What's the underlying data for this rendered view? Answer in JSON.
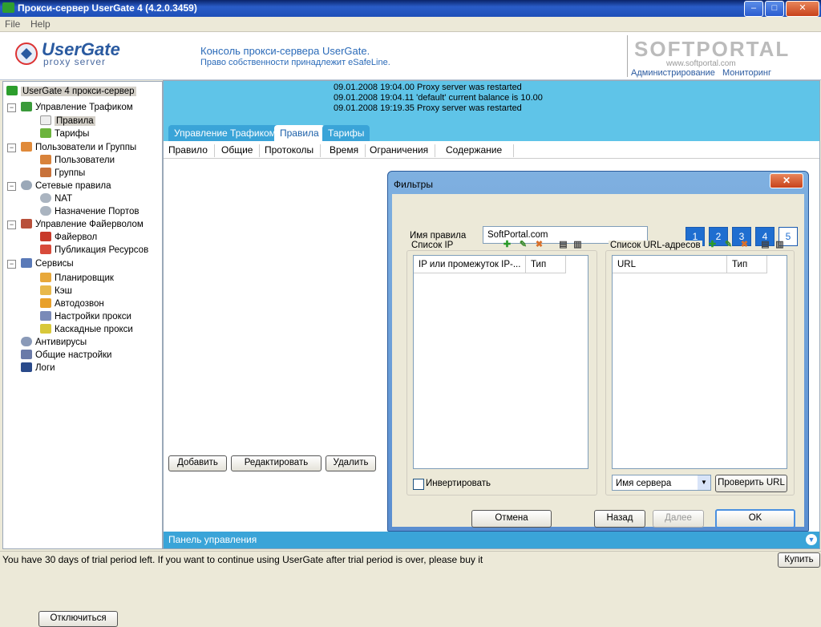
{
  "window": {
    "title": "Прокси-сервер UserGate 4 (4.2.0.3459)",
    "min": "–",
    "max": "□",
    "close": "✕"
  },
  "menu": {
    "file": "File",
    "help": "Help"
  },
  "header": {
    "logo_main": "UserGate",
    "logo_sub": "proxy server",
    "line1": "Консоль прокси-сервера UserGate.",
    "line2": "Право собственности принадлежит eSafeLine.",
    "watermark": "SOFTPORTAL",
    "watermark_url": "www.softportal.com",
    "admin_link": "Администрирование",
    "monitor_link": "Мониторинг"
  },
  "tree": {
    "root": "UserGate 4 прокси-сервер",
    "traffic": "Управление Трафиком",
    "rules": "Правила",
    "tariffs": "Тарифы",
    "users_groups": "Пользователи и Группы",
    "users": "Пользователи",
    "groups": "Группы",
    "net_rules": "Сетевые правила",
    "nat": "NAT",
    "ports": "Назначение Портов",
    "firewall_mgmt": "Управление Файерволом",
    "firewall": "Файервол",
    "publish": "Публикация Ресурсов",
    "services": "Сервисы",
    "scheduler": "Планировщик",
    "cache": "Кэш",
    "autodial": "Автодозвон",
    "proxy_settings": "Настройки прокси",
    "cascade": "Каскадные прокси",
    "antivirus": "Антивирусы",
    "general": "Общие настройки",
    "logs": "Логи"
  },
  "disconnect_label": "Отключиться",
  "log": [
    "09.01.2008 19:04.00 Proxy server was restarted",
    "09.01.2008 19:04.11 'default' current balance is 10.00",
    "09.01.2008 19:19.35 Proxy server was restarted"
  ],
  "tabs": [
    "Управление Трафиком",
    "Правила",
    "Тарифы"
  ],
  "columns": [
    "Правило",
    "Общие",
    "Протоколы",
    "Время",
    "Ограничения",
    "Содержание"
  ],
  "main_buttons": {
    "add": "Добавить",
    "edit": "Редактировать",
    "delete": "Удалить"
  },
  "panel_bar": "Панель управления",
  "status": {
    "message": "You have 30 days of trial period left. If you want to continue using UserGate after trial period is over, please buy it",
    "buy": "Купить"
  },
  "dialog": {
    "title": "Фильтры",
    "rule_name_label": "Имя правила",
    "rule_name_value": "SoftPortal.com",
    "pages": [
      "1",
      "2",
      "3",
      "4",
      "5"
    ],
    "ip_list_label": "Список IP",
    "ip_col1": "IP или промежуток IP-...",
    "ip_col2": "Тип",
    "url_list_label": "Список URL-адресов",
    "url_col1": "URL",
    "url_col2": "Тип",
    "invert_label": "Инвертировать",
    "server_select": "Имя сервера",
    "check_url": "Проверить URL",
    "cancel": "Отмена",
    "back": "Назад",
    "next": "Далее",
    "ok": "OK"
  }
}
